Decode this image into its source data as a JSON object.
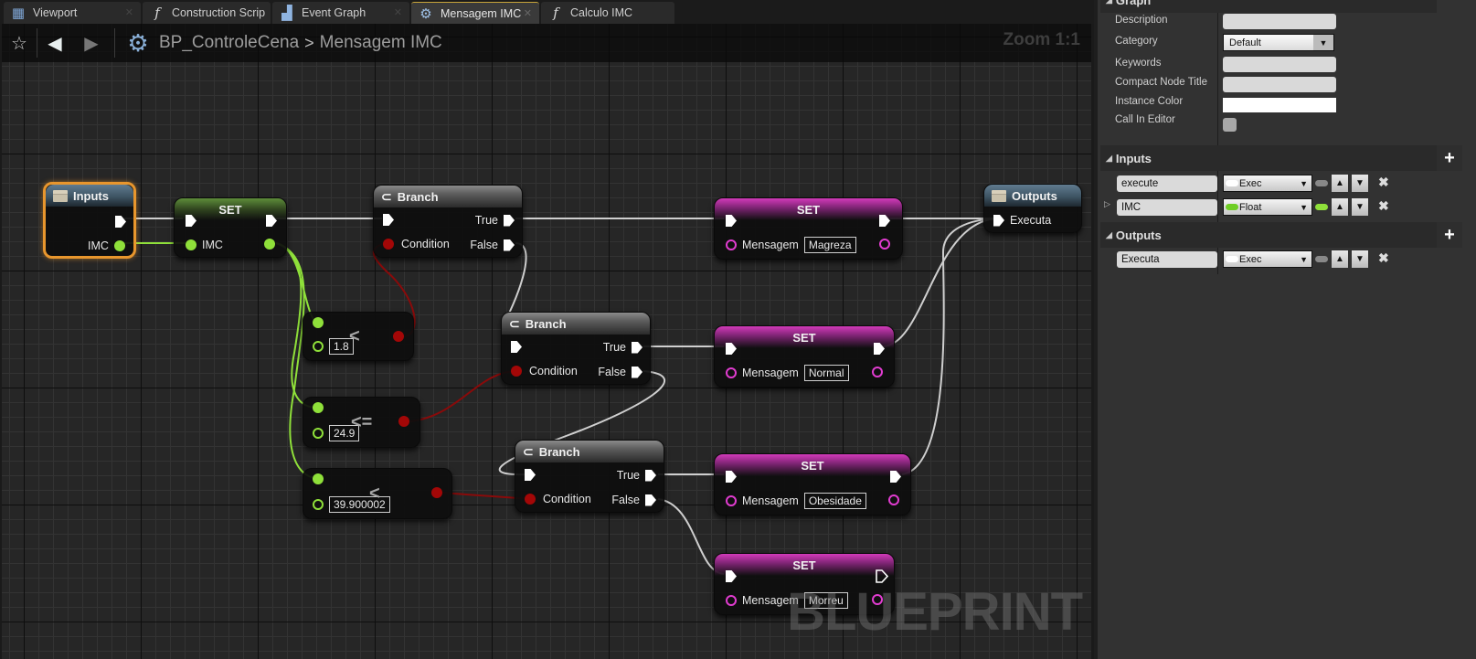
{
  "tabs": [
    {
      "label": "Viewport",
      "icon": "viewport-icon",
      "active": false
    },
    {
      "label": "Construction Scrip",
      "icon": "function-icon",
      "active": false
    },
    {
      "label": "Event Graph",
      "icon": "event-graph-icon",
      "active": false
    },
    {
      "label": "Mensagem IMC",
      "icon": "gear-icon",
      "active": true
    },
    {
      "label": "Calculo IMC",
      "icon": "function-icon",
      "active": false
    }
  ],
  "breadcrumb": {
    "blueprint": "BP_ControleCena",
    "separator": ">",
    "graph": "Mensagem IMC"
  },
  "zoom_label": "Zoom 1:1",
  "watermark": "BLUEPRINT",
  "nodes": {
    "inputs": {
      "title": "Inputs",
      "pin_imc": "IMC"
    },
    "set_imc": {
      "title": "SET",
      "pin_imc": "IMC"
    },
    "branch1": {
      "title": "Branch",
      "condition": "Condition",
      "true": "True",
      "false": "False"
    },
    "branch2": {
      "title": "Branch",
      "condition": "Condition",
      "true": "True",
      "false": "False"
    },
    "branch3": {
      "title": "Branch",
      "condition": "Condition",
      "true": "True",
      "false": "False"
    },
    "compare1": {
      "operator": "<",
      "value": "1.8"
    },
    "compare2": {
      "operator": "<=",
      "value": "24.9"
    },
    "compare3": {
      "operator": "<",
      "value": "39.900002"
    },
    "set_magreza": {
      "title": "SET",
      "pin": "Mensagem",
      "value": "Magreza"
    },
    "set_normal": {
      "title": "SET",
      "pin": "Mensagem",
      "value": "Normal"
    },
    "set_obesidade": {
      "title": "SET",
      "pin": "Mensagem",
      "value": "Obesidade"
    },
    "set_morreu": {
      "title": "SET",
      "pin": "Mensagem",
      "value": "Morreu"
    },
    "outputs": {
      "title": "Outputs",
      "pin": "Executa"
    }
  },
  "details": {
    "graph_section": "Graph",
    "properties": {
      "description_label": "Description",
      "description_value": "",
      "category_label": "Category",
      "category_value": "Default",
      "keywords_label": "Keywords",
      "keywords_value": "",
      "compact_title_label": "Compact Node Title",
      "compact_title_value": "",
      "instance_color_label": "Instance Color",
      "instance_color_value": "#ffffff",
      "call_in_editor_label": "Call In Editor",
      "call_in_editor_checked": false
    },
    "inputs_section": "Inputs",
    "inputs": [
      {
        "name": "execute",
        "type": "Exec",
        "color": "#ffffff"
      },
      {
        "name": "IMC",
        "type": "Float",
        "color": "#8fe03a"
      }
    ],
    "outputs_section": "Outputs",
    "outputs": [
      {
        "name": "Executa",
        "type": "Exec",
        "color": "#ffffff"
      }
    ]
  },
  "colors": {
    "exec": "#ffffff",
    "float": "#8fe03a",
    "bool": "#a30707",
    "string": "#e13cd0",
    "selection": "#e8962d"
  }
}
